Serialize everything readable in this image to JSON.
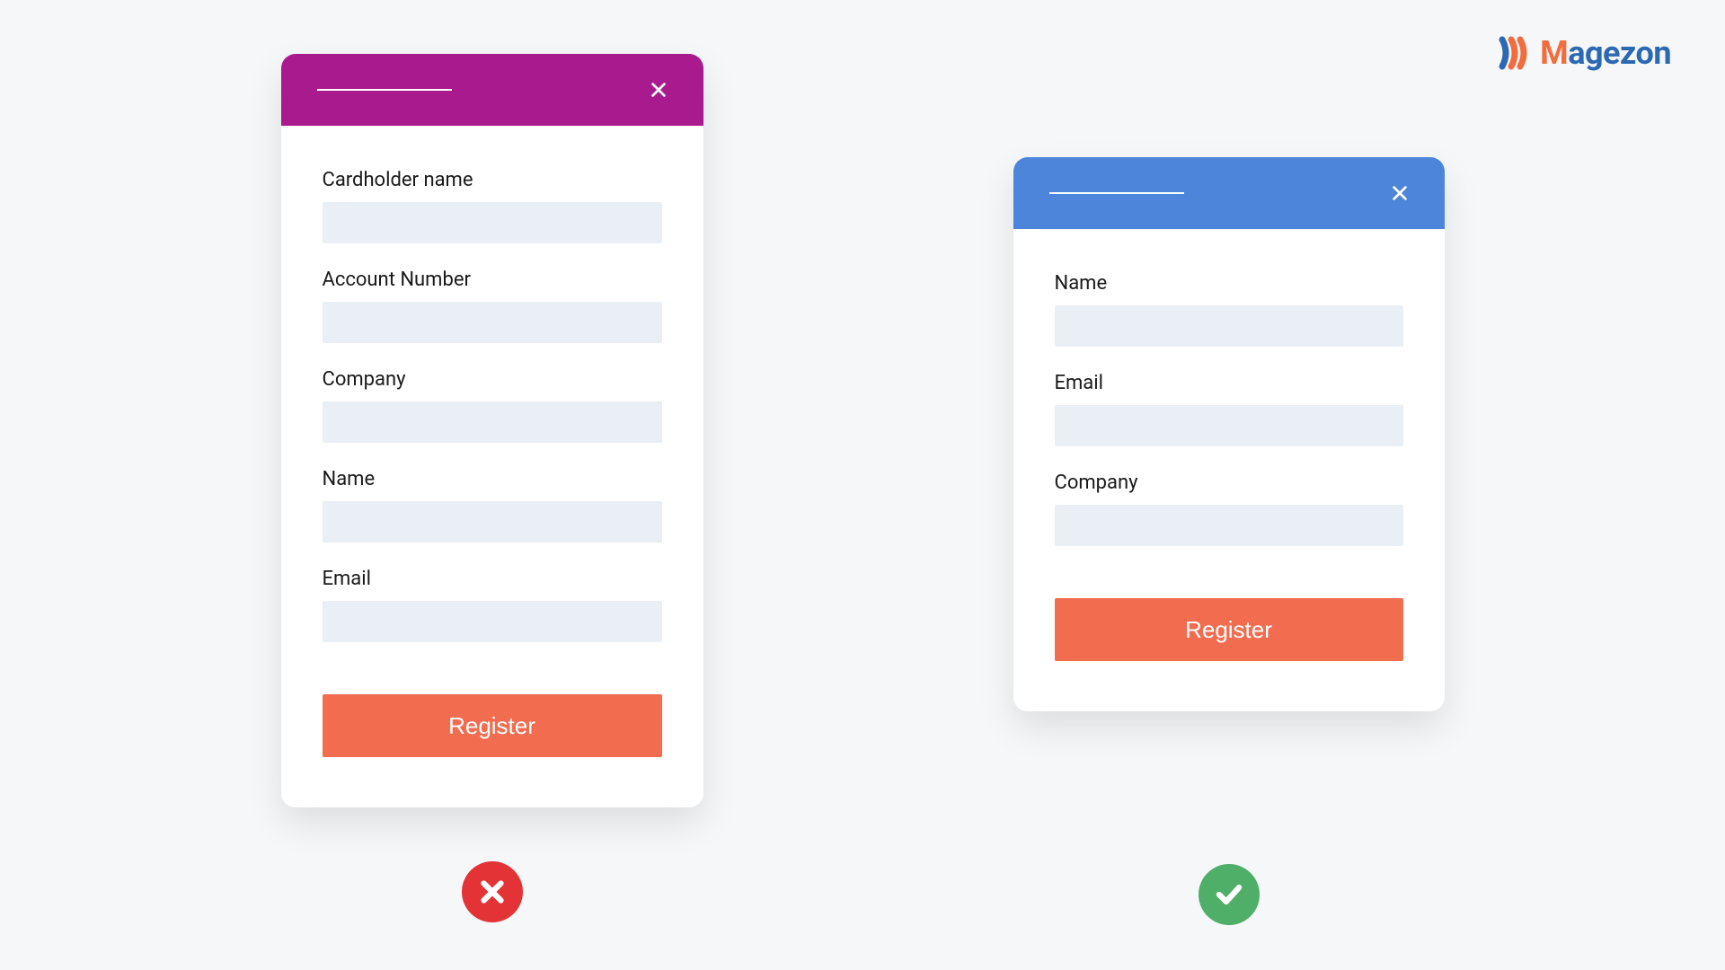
{
  "logo": {
    "text_first": "M",
    "text_rest": "agezon",
    "colors": {
      "accent": "#f26c3e",
      "primary": "#2c69b3"
    }
  },
  "left_form": {
    "header_color": "#a91a8f",
    "fields": [
      {
        "label": "Cardholder name"
      },
      {
        "label": "Account Number"
      },
      {
        "label": "Company"
      },
      {
        "label": "Name"
      },
      {
        "label": "Email"
      }
    ],
    "submit_label": "Register",
    "status": "bad"
  },
  "right_form": {
    "header_color": "#4c85d9",
    "fields": [
      {
        "label": "Name"
      },
      {
        "label": "Email"
      },
      {
        "label": "Company"
      }
    ],
    "submit_label": "Register",
    "status": "good"
  }
}
